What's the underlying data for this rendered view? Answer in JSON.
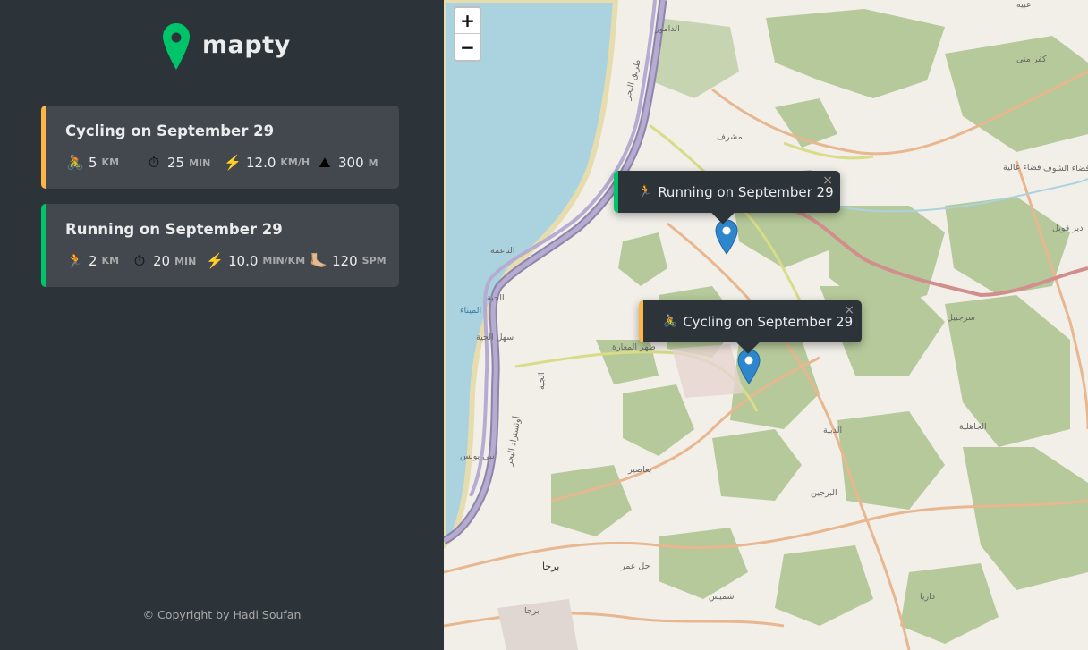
{
  "app": {
    "name": "mapty",
    "brand_color": "#00c46a"
  },
  "workouts": [
    {
      "type": "cycling",
      "title": "Cycling on September 29",
      "accent": "#ffb545",
      "details": [
        {
          "icon": "🚴",
          "icon_name": "cyclist-icon",
          "value": "5",
          "unit": "km"
        },
        {
          "icon": "⏱",
          "icon_name": "stopwatch-icon",
          "value": "25",
          "unit": "min"
        },
        {
          "icon": "⚡️",
          "icon_name": "lightning-icon",
          "value": "12.0",
          "unit": "km/h"
        },
        {
          "icon": "⛰",
          "icon_name": "mountain-icon",
          "value": "300",
          "unit": "m"
        }
      ]
    },
    {
      "type": "running",
      "title": "Running on September 29",
      "accent": "#00c46a",
      "details": [
        {
          "icon": "🏃",
          "icon_name": "runner-icon",
          "value": "2",
          "unit": "km"
        },
        {
          "icon": "⏱",
          "icon_name": "stopwatch-icon",
          "value": "20",
          "unit": "min"
        },
        {
          "icon": "⚡️",
          "icon_name": "lightning-icon",
          "value": "10.0",
          "unit": "min/km"
        },
        {
          "icon": "🦶🏼",
          "icon_name": "foot-icon",
          "value": "120",
          "unit": "spm"
        }
      ]
    }
  ],
  "footer": {
    "prefix": "© Copyright by ",
    "author": "Hadi Soufan"
  },
  "map": {
    "zoom_in": "+",
    "zoom_out": "−",
    "popups": [
      {
        "type": "running",
        "icon": "🏃",
        "text": "Running on September 29",
        "close": "×"
      },
      {
        "type": "cycling",
        "icon": "🚴",
        "text": "Cycling on September 29",
        "close": "×"
      }
    ],
    "labels": [
      "الدامور",
      "مشرف",
      "فضاء عالية",
      "فضاء الشوف",
      "عبيه",
      "كفر متى",
      "الناعمة",
      "الجية",
      "الميناء",
      "سهل الجية",
      "ضهر المغارة",
      "سرجبيل",
      "الدبية",
      "الجاهلية",
      "بعاصير",
      "البرجين",
      "برجا",
      "حل عمر",
      "شميس",
      "داريا",
      "برجا",
      "نبي يونس",
      "طريق البحر",
      "أوتستراد البحر",
      "الجية",
      "دير قوبل"
    ]
  }
}
